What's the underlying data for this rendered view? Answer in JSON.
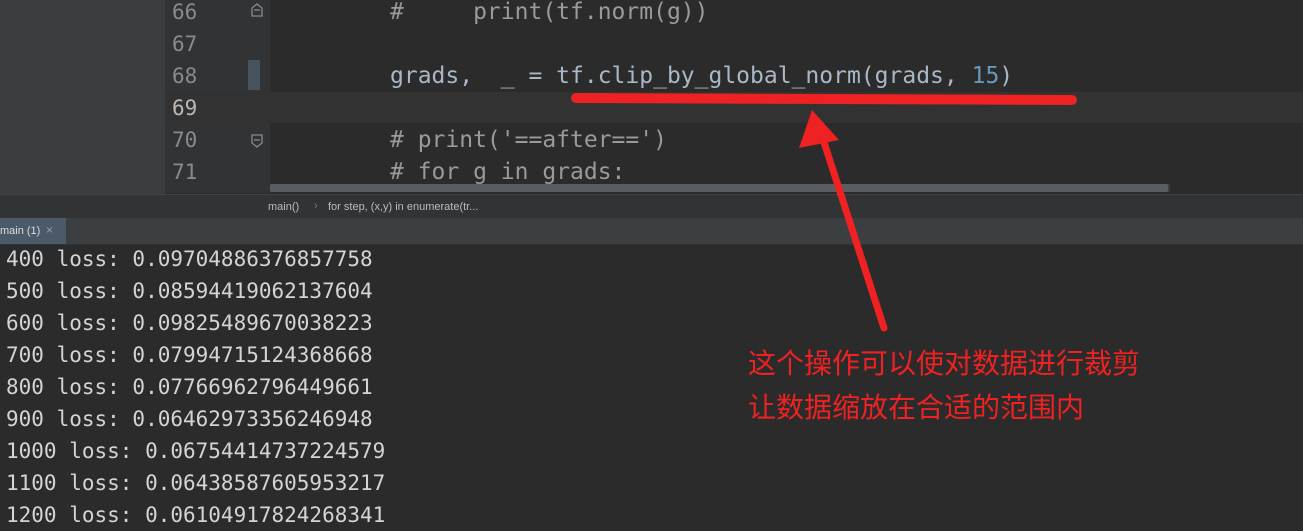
{
  "editor": {
    "line_numbers": [
      "66",
      "67",
      "68",
      "69",
      "70",
      "71"
    ],
    "code_lines": {
      "l66": "#     print(tf.norm(g))",
      "l68_a": "grads,  _ = tf.clip_by_global_norm(grads, ",
      "l68_num": "15",
      "l68_b": ")",
      "l70": "# print('==after==')",
      "l71": "# for g in grads:"
    },
    "breadcrumb": [
      "main()",
      "for step, (x,y) in enumerate(tr..."
    ]
  },
  "run_panel": {
    "tab_label": "main (1)",
    "tab_close": "×"
  },
  "console": {
    "lines": [
      "400 loss: 0.09704886376857758",
      "500 loss: 0.08594419062137604",
      "600 loss: 0.09825489670038223",
      "700 loss: 0.07994715124368668",
      "800 loss: 0.07766962796449661",
      "900 loss: 0.06462973356246948",
      "1000 loss: 0.06754414737224579",
      "1100 loss: 0.06438587605953217",
      "1200 loss: 0.06104917824268341"
    ]
  },
  "annotation": {
    "line1": "这个操作可以使对数据进行裁剪",
    "line2": "让数据缩放在合适的范围内",
    "color": "#ee2222"
  },
  "colors": {
    "editor_bg": "#2b2b2b",
    "gutter_bg": "#313335",
    "number_literal": "#6897bb",
    "annotation_red": "#ee2222"
  }
}
